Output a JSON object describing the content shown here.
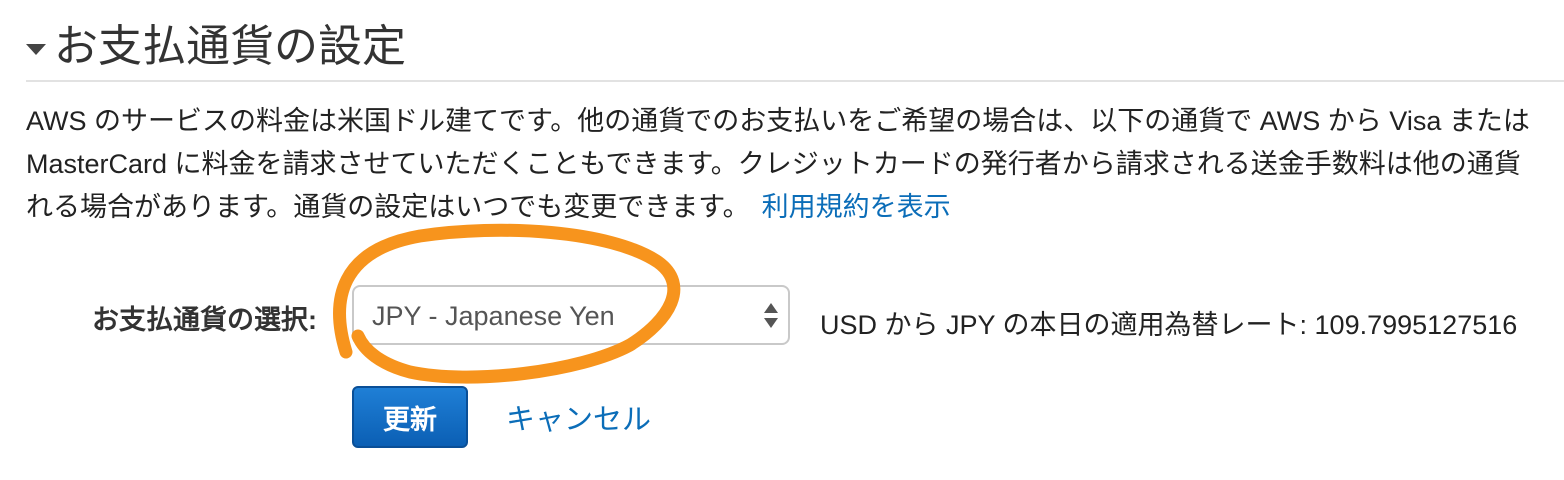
{
  "section": {
    "title": "お支払通貨の設定"
  },
  "description": {
    "line1": "AWS のサービスの料金は米国ドル建てです。他の通貨でのお支払いをご希望の場合は、以下の通貨で AWS から Visa または",
    "line2": "MasterCard に料金を請求させていただくこともできます。クレジットカードの発行者から請求される送金手数料は他の通貨",
    "line3": "れる場合があります。通貨の設定はいつでも変更できます。",
    "terms_link": "利用規約を表示"
  },
  "currency": {
    "label": "お支払通貨の選択:",
    "selected": "JPY - Japanese Yen",
    "rate_text": "USD から JPY の本日の適用為替レート: 109.7995127516"
  },
  "actions": {
    "update_label": "更新",
    "cancel_label": "キャンセル"
  },
  "colors": {
    "link": "#0b6db8",
    "primary_button": "#1270c8",
    "annotation": "#f7941d"
  }
}
